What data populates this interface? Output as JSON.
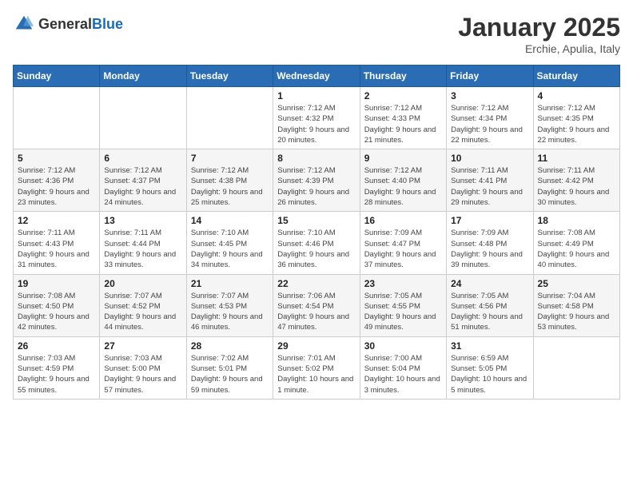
{
  "logo": {
    "general": "General",
    "blue": "Blue"
  },
  "header": {
    "month": "January 2025",
    "location": "Erchie, Apulia, Italy"
  },
  "weekdays": [
    "Sunday",
    "Monday",
    "Tuesday",
    "Wednesday",
    "Thursday",
    "Friday",
    "Saturday"
  ],
  "weeks": [
    [
      {
        "day": "",
        "info": ""
      },
      {
        "day": "",
        "info": ""
      },
      {
        "day": "",
        "info": ""
      },
      {
        "day": "1",
        "info": "Sunrise: 7:12 AM\nSunset: 4:32 PM\nDaylight: 9 hours\nand 20 minutes."
      },
      {
        "day": "2",
        "info": "Sunrise: 7:12 AM\nSunset: 4:33 PM\nDaylight: 9 hours\nand 21 minutes."
      },
      {
        "day": "3",
        "info": "Sunrise: 7:12 AM\nSunset: 4:34 PM\nDaylight: 9 hours\nand 22 minutes."
      },
      {
        "day": "4",
        "info": "Sunrise: 7:12 AM\nSunset: 4:35 PM\nDaylight: 9 hours\nand 22 minutes."
      }
    ],
    [
      {
        "day": "5",
        "info": "Sunrise: 7:12 AM\nSunset: 4:36 PM\nDaylight: 9 hours\nand 23 minutes."
      },
      {
        "day": "6",
        "info": "Sunrise: 7:12 AM\nSunset: 4:37 PM\nDaylight: 9 hours\nand 24 minutes."
      },
      {
        "day": "7",
        "info": "Sunrise: 7:12 AM\nSunset: 4:38 PM\nDaylight: 9 hours\nand 25 minutes."
      },
      {
        "day": "8",
        "info": "Sunrise: 7:12 AM\nSunset: 4:39 PM\nDaylight: 9 hours\nand 26 minutes."
      },
      {
        "day": "9",
        "info": "Sunrise: 7:12 AM\nSunset: 4:40 PM\nDaylight: 9 hours\nand 28 minutes."
      },
      {
        "day": "10",
        "info": "Sunrise: 7:11 AM\nSunset: 4:41 PM\nDaylight: 9 hours\nand 29 minutes."
      },
      {
        "day": "11",
        "info": "Sunrise: 7:11 AM\nSunset: 4:42 PM\nDaylight: 9 hours\nand 30 minutes."
      }
    ],
    [
      {
        "day": "12",
        "info": "Sunrise: 7:11 AM\nSunset: 4:43 PM\nDaylight: 9 hours\nand 31 minutes."
      },
      {
        "day": "13",
        "info": "Sunrise: 7:11 AM\nSunset: 4:44 PM\nDaylight: 9 hours\nand 33 minutes."
      },
      {
        "day": "14",
        "info": "Sunrise: 7:10 AM\nSunset: 4:45 PM\nDaylight: 9 hours\nand 34 minutes."
      },
      {
        "day": "15",
        "info": "Sunrise: 7:10 AM\nSunset: 4:46 PM\nDaylight: 9 hours\nand 36 minutes."
      },
      {
        "day": "16",
        "info": "Sunrise: 7:09 AM\nSunset: 4:47 PM\nDaylight: 9 hours\nand 37 minutes."
      },
      {
        "day": "17",
        "info": "Sunrise: 7:09 AM\nSunset: 4:48 PM\nDaylight: 9 hours\nand 39 minutes."
      },
      {
        "day": "18",
        "info": "Sunrise: 7:08 AM\nSunset: 4:49 PM\nDaylight: 9 hours\nand 40 minutes."
      }
    ],
    [
      {
        "day": "19",
        "info": "Sunrise: 7:08 AM\nSunset: 4:50 PM\nDaylight: 9 hours\nand 42 minutes."
      },
      {
        "day": "20",
        "info": "Sunrise: 7:07 AM\nSunset: 4:52 PM\nDaylight: 9 hours\nand 44 minutes."
      },
      {
        "day": "21",
        "info": "Sunrise: 7:07 AM\nSunset: 4:53 PM\nDaylight: 9 hours\nand 46 minutes."
      },
      {
        "day": "22",
        "info": "Sunrise: 7:06 AM\nSunset: 4:54 PM\nDaylight: 9 hours\nand 47 minutes."
      },
      {
        "day": "23",
        "info": "Sunrise: 7:05 AM\nSunset: 4:55 PM\nDaylight: 9 hours\nand 49 minutes."
      },
      {
        "day": "24",
        "info": "Sunrise: 7:05 AM\nSunset: 4:56 PM\nDaylight: 9 hours\nand 51 minutes."
      },
      {
        "day": "25",
        "info": "Sunrise: 7:04 AM\nSunset: 4:58 PM\nDaylight: 9 hours\nand 53 minutes."
      }
    ],
    [
      {
        "day": "26",
        "info": "Sunrise: 7:03 AM\nSunset: 4:59 PM\nDaylight: 9 hours\nand 55 minutes."
      },
      {
        "day": "27",
        "info": "Sunrise: 7:03 AM\nSunset: 5:00 PM\nDaylight: 9 hours\nand 57 minutes."
      },
      {
        "day": "28",
        "info": "Sunrise: 7:02 AM\nSunset: 5:01 PM\nDaylight: 9 hours\nand 59 minutes."
      },
      {
        "day": "29",
        "info": "Sunrise: 7:01 AM\nSunset: 5:02 PM\nDaylight: 10 hours\nand 1 minute."
      },
      {
        "day": "30",
        "info": "Sunrise: 7:00 AM\nSunset: 5:04 PM\nDaylight: 10 hours\nand 3 minutes."
      },
      {
        "day": "31",
        "info": "Sunrise: 6:59 AM\nSunset: 5:05 PM\nDaylight: 10 hours\nand 5 minutes."
      },
      {
        "day": "",
        "info": ""
      }
    ]
  ]
}
